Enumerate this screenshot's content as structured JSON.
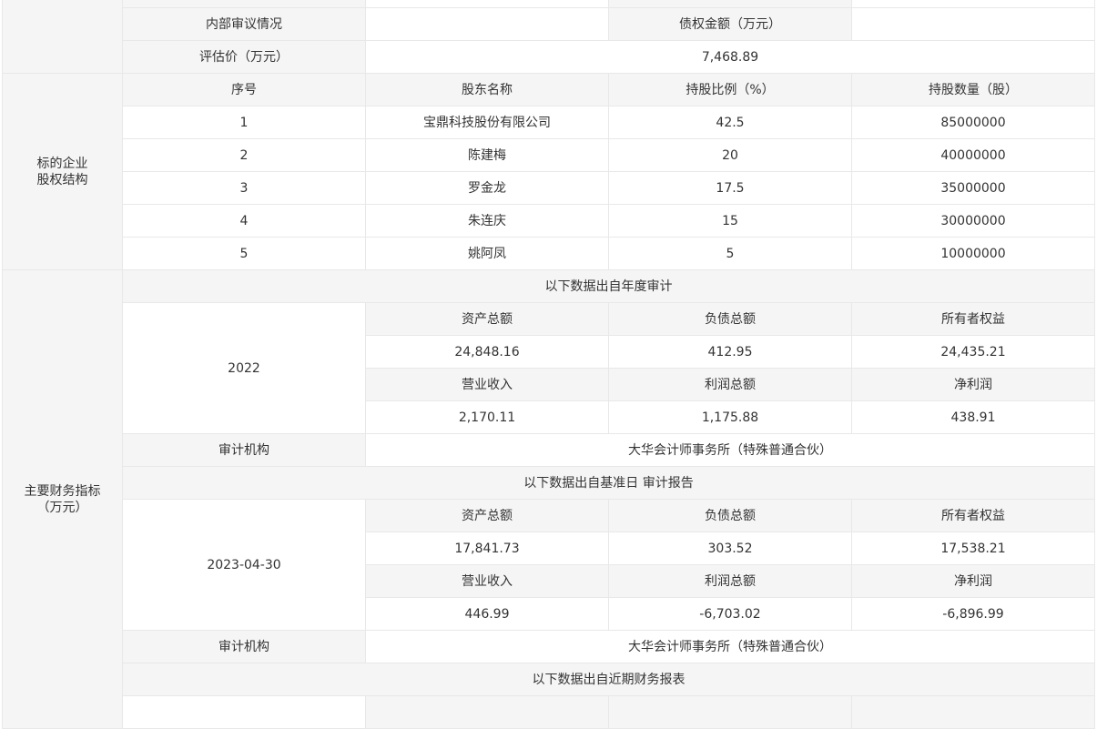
{
  "top": {
    "internal_review_label": "内部审议情况",
    "internal_review_value": "",
    "claim_amount_label": "债权金额（万元）",
    "claim_amount_value": "",
    "valuation_label": "评估价（万元）",
    "valuation_value": "7,468.89"
  },
  "equity": {
    "section_label_line1": "标的企业",
    "section_label_line2": "股权结构",
    "headers": [
      "序号",
      "股东名称",
      "持股比例（%）",
      "持股数量（股）"
    ],
    "rows": [
      [
        "1",
        "宝鼎科技股份有限公司",
        "42.5",
        "85000000"
      ],
      [
        "2",
        "陈建梅",
        "20",
        "40000000"
      ],
      [
        "3",
        "罗金龙",
        "17.5",
        "35000000"
      ],
      [
        "4",
        "朱连庆",
        "15",
        "30000000"
      ],
      [
        "5",
        "姚阿凤",
        "5",
        "10000000"
      ]
    ]
  },
  "finance": {
    "section_label_line1": "主要财务指标",
    "section_label_line2": "（万元）",
    "annual": {
      "caption": "以下数据出自年度审计",
      "period": "2022",
      "header1": [
        "资产总额",
        "负债总额",
        "所有者权益"
      ],
      "values1": [
        "24,848.16",
        "412.95",
        "24,435.21"
      ],
      "header2": [
        "营业收入",
        "利润总额",
        "净利润"
      ],
      "values2": [
        "2,170.11",
        "1,175.88",
        "438.91"
      ],
      "auditor_label": "审计机构",
      "auditor_value": "大华会计师事务所（特殊普通合伙）"
    },
    "base_date": {
      "caption": "以下数据出自基准日 审计报告",
      "period": "2023-04-30",
      "header1": [
        "资产总额",
        "负债总额",
        "所有者权益"
      ],
      "values1": [
        "17,841.73",
        "303.52",
        "17,538.21"
      ],
      "header2": [
        "营业收入",
        "利润总额",
        "净利润"
      ],
      "values2": [
        "446.99",
        "-6,703.02",
        "-6,896.99"
      ],
      "auditor_label": "审计机构",
      "auditor_value": "大华会计师事务所（特殊普通合伙）"
    },
    "recent_caption": "以下数据出自近期财务报表"
  }
}
